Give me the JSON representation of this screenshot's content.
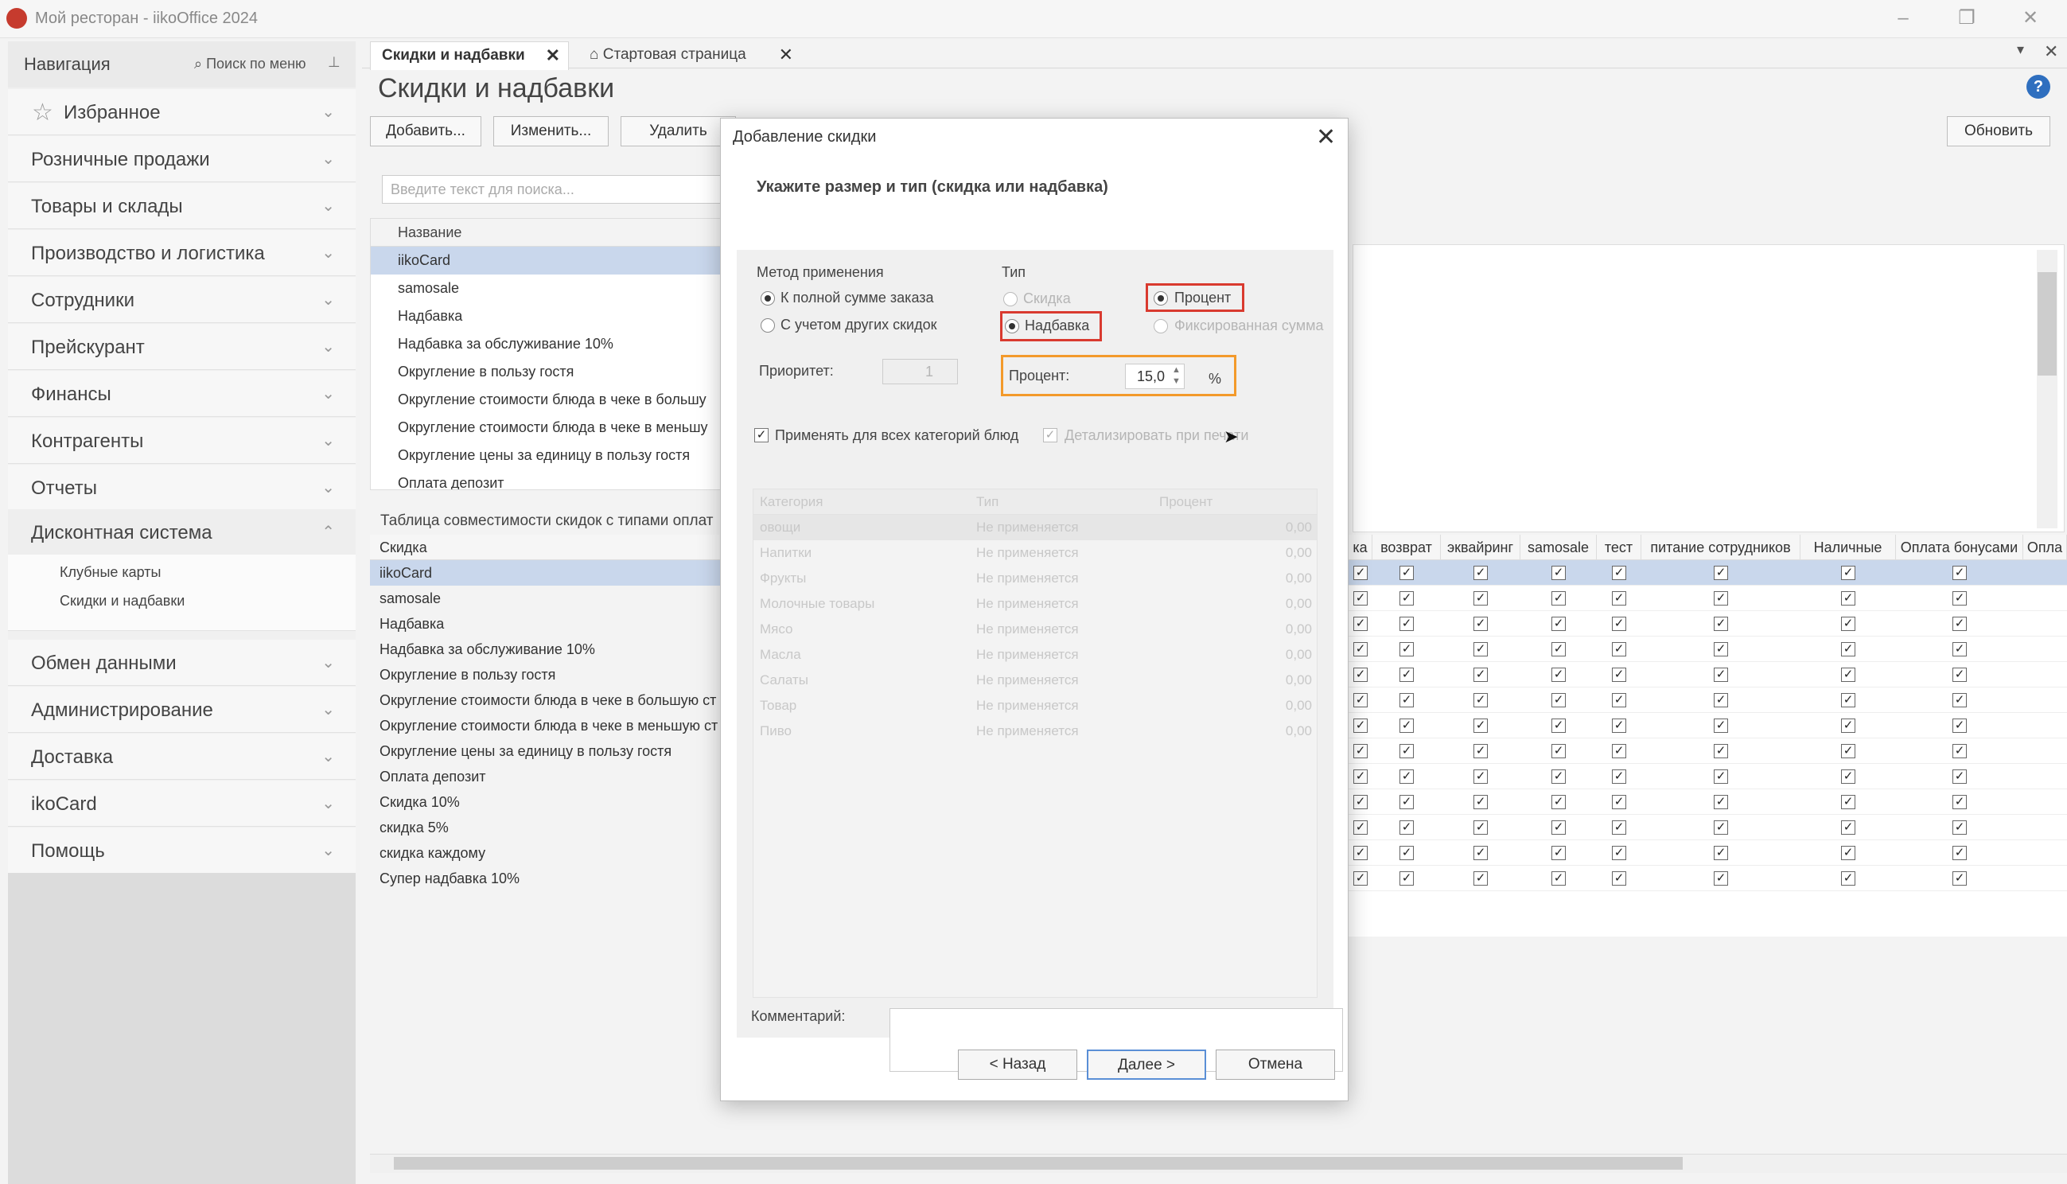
{
  "window": {
    "title": "Мой ресторан - iikoOffice 2024",
    "minimize": "–",
    "restore": "❐",
    "close": "✕"
  },
  "nav": {
    "title": "Навигация",
    "search_label": "⌕ Поиск по меню",
    "pin": "⊥",
    "favorites": "Избранное",
    "items": [
      "Розничные продажи",
      "Товары и склады",
      "Производство и логистика",
      "Сотрудники",
      "Прейскурант",
      "Финансы",
      "Контрагенты",
      "Отчеты",
      "Дисконтная система"
    ],
    "sub_items": [
      "Клубные карты",
      "Скидки и надбавки"
    ],
    "items_after": [
      "Обмен данными",
      "Администрирование",
      "Доставка",
      "ikoCard",
      "Помощь"
    ]
  },
  "tabs": [
    {
      "label": "Скидки и надбавки",
      "close": "✕"
    },
    {
      "label": "⌂ Стартовая страница",
      "close": "✕"
    }
  ],
  "tab_menu": "▾",
  "tab_close_all": "✕",
  "page_title": "Скидки и надбавки",
  "toolbar": {
    "add": "Добавить...",
    "edit": "Изменить...",
    "delete": "Удалить",
    "refresh": "Обновить"
  },
  "search": {
    "placeholder": "Введите текст для поиска..."
  },
  "top_list": {
    "header": "Название",
    "rows": [
      "iikoCard",
      "samosale",
      "Надбавка",
      "Надбавка за обслуживание 10%",
      "Округление в пользу гостя",
      "Округление стоимости блюда в чеке в большу",
      "Округление стоимости блюда в чеке в меньшу",
      "Округление цены за единицу в пользу гостя",
      "Оплата депозит"
    ]
  },
  "compat": {
    "title": "Таблица совместимости скидок с типами оплат",
    "header": "Скидка",
    "rows": [
      "iikoCard",
      "samosale",
      "Надбавка",
      "Надбавка за обслуживание 10%",
      "Округление в пользу гостя",
      "Округление стоимости блюда в чеке в большую ст",
      "Округление стоимости блюда в чеке в меньшую ст",
      "Округление цены за единицу в пользу гостя",
      "Оплата депозит",
      "Скидка 10%",
      "скидка 5%",
      "скидка каждому",
      "Супер надбавка 10%"
    ],
    "columns": [
      "ка",
      "возврат",
      "эквайринг",
      "samosale",
      "тест",
      "питание сотрудников",
      "Наличные",
      "Оплата бонусами",
      "Опла"
    ],
    "check": "✓"
  },
  "dialog": {
    "title": "Добавление скидки",
    "close": "✕",
    "heading": "Укажите размер и тип (скидка или надбавка)",
    "method_group": "Метод применения",
    "method_full": "К полной сумме заказа",
    "method_other": "С учетом других скидок",
    "priority_label": "Приоритет:",
    "priority_value": "1",
    "type_group": "Тип",
    "type_discount": "Скидка",
    "type_markup": "Надбавка",
    "type_percent": "Процент",
    "type_fixed": "Фиксированная сумма",
    "percent_label": "Процент:",
    "percent_value": "15,0",
    "percent_unit": "%",
    "apply_all": "Применять для всех категорий блюд",
    "detail_print": "Детализировать при печати",
    "cat_headers": [
      "Категория",
      "Тип",
      "Процент"
    ],
    "cat_rows": [
      [
        "овощи",
        "Не применяется",
        "0,00"
      ],
      [
        "Напитки",
        "Не применяется",
        "0,00"
      ],
      [
        "Фрукты",
        "Не применяется",
        "0,00"
      ],
      [
        "Молочные товары",
        "Не применяется",
        "0,00"
      ],
      [
        "Мясо",
        "Не применяется",
        "0,00"
      ],
      [
        "Масла",
        "Не применяется",
        "0,00"
      ],
      [
        "Салаты",
        "Не применяется",
        "0,00"
      ],
      [
        "Товар",
        "Не применяется",
        "0,00"
      ],
      [
        "Пиво",
        "Не применяется",
        "0,00"
      ]
    ],
    "comment_label": "Комментарий:",
    "btn_back": "< Назад",
    "btn_next": "Далее >",
    "btn_cancel": "Отмена"
  },
  "colors": {
    "selection": "#c9d7ec",
    "annotation_red": "#d93a2f",
    "annotation_orange": "#f39a2b",
    "help_blue": "#2f6fbf"
  }
}
